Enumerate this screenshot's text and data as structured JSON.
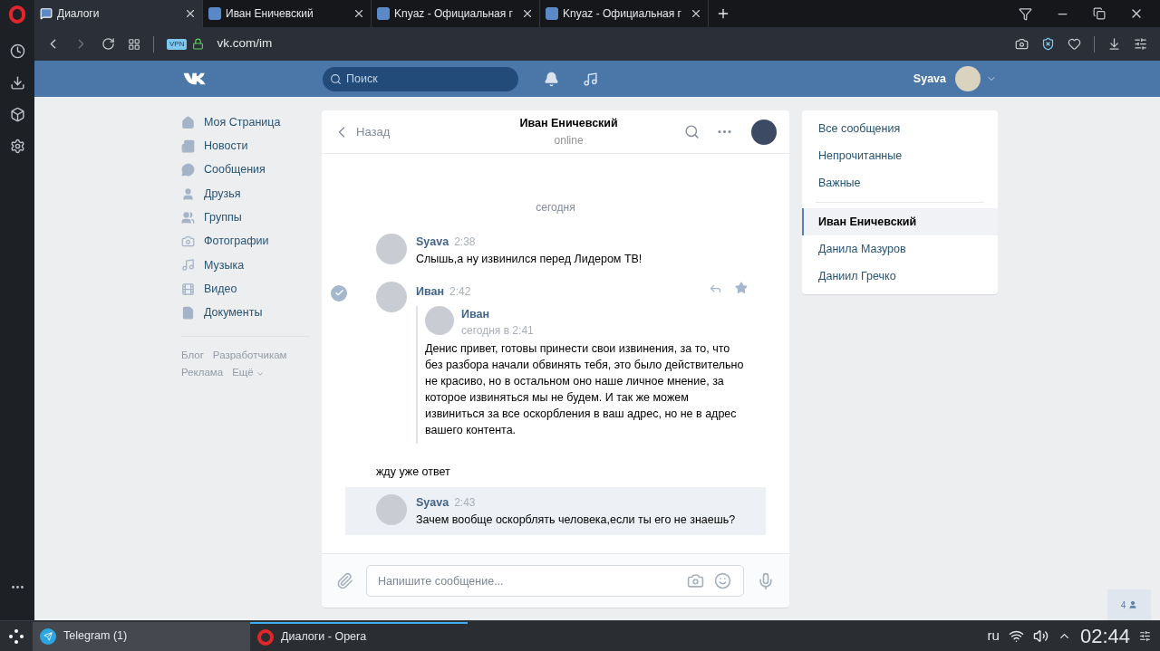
{
  "browser": {
    "tabs": [
      {
        "label": "Диалоги",
        "selected": true
      },
      {
        "label": "Иван Еничевский",
        "selected": false
      },
      {
        "label": "Knyaz - Официальная г",
        "selected": false
      },
      {
        "label": "Knyaz - Официальная г",
        "selected": false
      }
    ],
    "vpn": "VPN",
    "url": "vk.com/im"
  },
  "header": {
    "search_placeholder": "Поиск",
    "user": "Syava"
  },
  "nav": {
    "items": [
      "Моя Страница",
      "Новости",
      "Сообщения",
      "Друзья",
      "Группы",
      "Фотографии",
      "Музыка",
      "Видео",
      "Документы"
    ],
    "footer": [
      "Блог",
      "Разработчикам",
      "Реклама",
      "Ещё"
    ]
  },
  "chat": {
    "back": "Назад",
    "title": "Иван Еничевский",
    "status": "online",
    "date": "сегодня",
    "messages": [
      {
        "author": "Syava",
        "time": "2:38",
        "text": "Слышь,а ну извинился перед Лидером ТВ!",
        "hovered": false,
        "unread": false
      },
      {
        "author": "Иван",
        "time": "2:42",
        "hovered": true,
        "unread": false,
        "forward": {
          "author": "Иван",
          "time": "сегодня в 2:41",
          "text": "Денис привет, готовы принести свои извинения, за то, что без разбора начали обвинять тебя, это было действительно не красиво, но в остальном оно наше личное мнение, за которое извиняться мы не будем. И так же можем извиниться за все оскорбления в ваш адрес, но не в адрес вашего контента."
        },
        "text": "жду уже ответ"
      },
      {
        "author": "Syava",
        "time": "2:43",
        "text": "Зачем вообще оскорблять человека,если ты его не знаешь?",
        "hovered": false,
        "unread": true
      }
    ],
    "composer_placeholder": "Напишите сообщение..."
  },
  "filters": [
    {
      "label": "Все сообщения",
      "selected": false
    },
    {
      "label": "Непрочитанные",
      "selected": false
    },
    {
      "label": "Важные",
      "selected": false
    }
  ],
  "dialogs": [
    {
      "label": "Иван Еничевский",
      "selected": true
    },
    {
      "label": "Данила Мазуров",
      "selected": false
    },
    {
      "label": "Даниил Гречко",
      "selected": false
    }
  ],
  "online_count": "4",
  "taskbar": {
    "items": [
      {
        "label": "Telegram (1)",
        "active": false
      },
      {
        "label": "Диалоги - Opera",
        "active": true
      }
    ],
    "lang": "ru",
    "clock": "02:44"
  }
}
